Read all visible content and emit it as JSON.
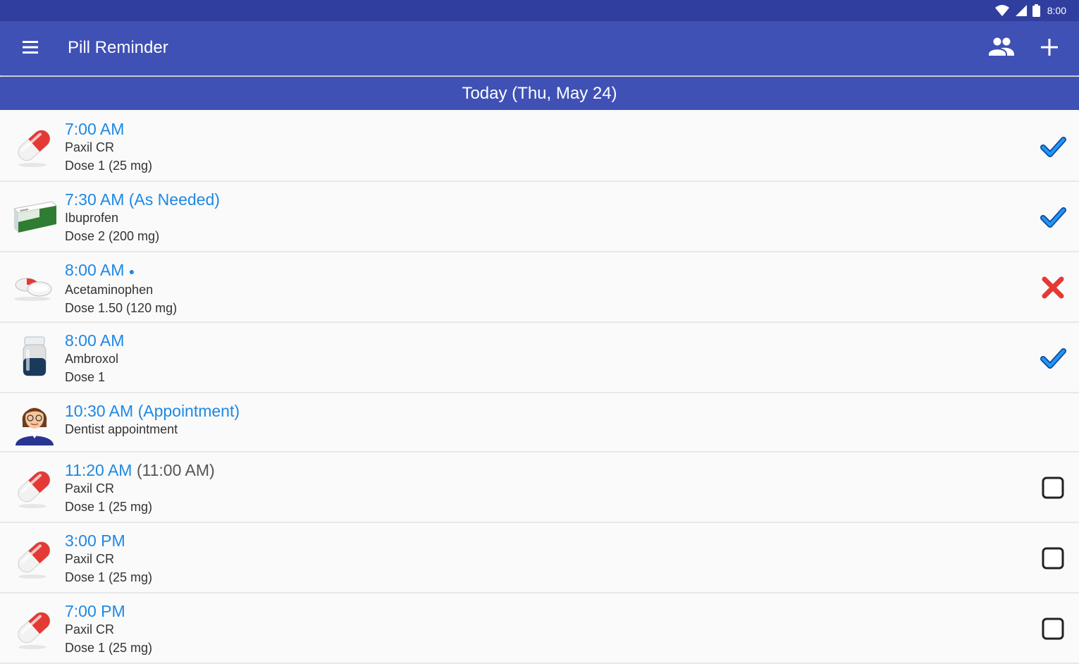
{
  "status_bar": {
    "time": "8:00"
  },
  "app_bar": {
    "title": "Pill Reminder"
  },
  "date_header": "Today (Thu, May 24)",
  "colors": {
    "primary": "#3f51b5",
    "primary_dark": "#303f9f",
    "accent_blue": "#1e88e5",
    "missed_red": "#e53935"
  },
  "items": [
    {
      "time": "7:00 AM",
      "name": "Paxil CR",
      "dose": "Dose 1 (25 mg)",
      "icon": "pill-capsule-icon",
      "status": "taken-check-icon"
    },
    {
      "time": "7:30 AM (As Needed)",
      "name": "Ibuprofen",
      "dose": "Dose 2 (200 mg)",
      "icon": "medicine-box-icon",
      "status": "taken-check-icon"
    },
    {
      "time": "8:00 AM",
      "name": "Acetaminophen",
      "dose": "Dose 1.50 (120 mg)",
      "icon": "tablets-icon",
      "status": "missed-x-icon"
    },
    {
      "time": "8:00 AM",
      "name": "Ambroxol",
      "dose": "Dose 1",
      "icon": "medicine-bottle-icon",
      "status": "taken-check-icon"
    },
    {
      "time": "10:30 AM (Appointment)",
      "name": "Dentist appointment",
      "icon": "doctor-avatar-icon"
    },
    {
      "time": "11:20 AM",
      "original_time": "(11:00 AM)",
      "name": "Paxil CR",
      "dose": "Dose 1 (25 mg)",
      "icon": "pill-capsule-icon",
      "status": "pending-checkbox"
    },
    {
      "time": "3:00 PM",
      "name": "Paxil CR",
      "dose": "Dose 1 (25 mg)",
      "icon": "pill-capsule-icon",
      "status": "pending-checkbox"
    },
    {
      "time": "7:00 PM",
      "name": "Paxil CR",
      "dose": "Dose 1 (25 mg)",
      "icon": "pill-capsule-icon",
      "status": "pending-checkbox"
    }
  ]
}
